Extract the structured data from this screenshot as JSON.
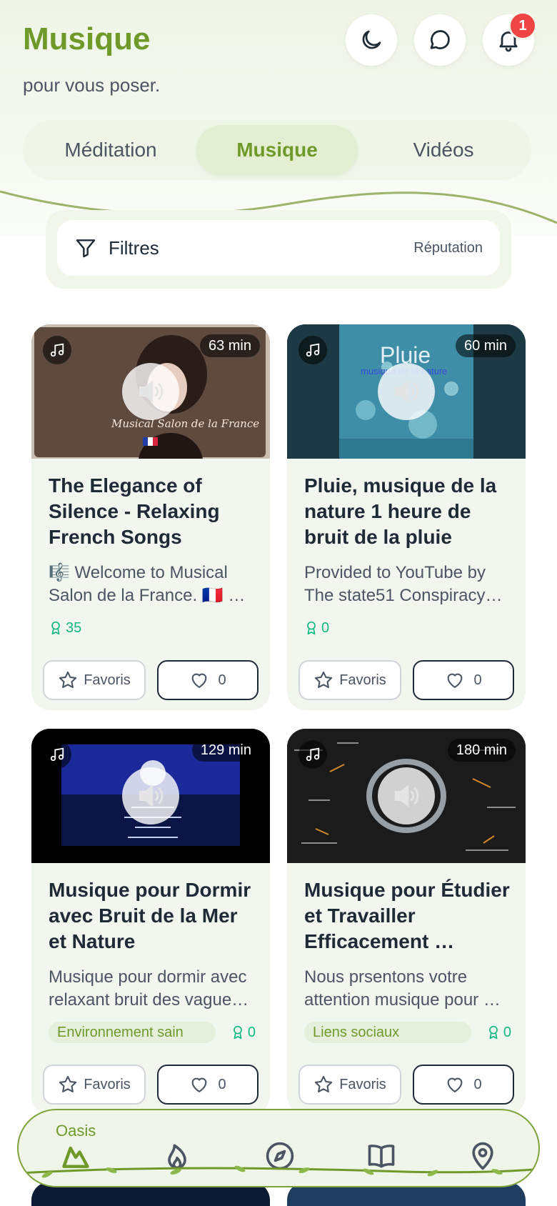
{
  "header": {
    "title": "Musique",
    "subtitle": "pour vous poser.",
    "notification_count": "1",
    "icons": [
      "moon-icon",
      "chat-icon",
      "bell-icon"
    ]
  },
  "tabs": [
    {
      "label": "Méditation",
      "active": false
    },
    {
      "label": "Musique",
      "active": true
    },
    {
      "label": "Vidéos",
      "active": false
    }
  ],
  "filters": {
    "label": "Filtres",
    "sort_label": "Réputation"
  },
  "cards": [
    {
      "duration": "63 min",
      "title": "The Elegance of Silence - Relaxing French Songs",
      "description": "🎼 Welcome to Musical Salon de la France. 🇫🇷 …",
      "tag": "",
      "points": "35",
      "favorite_label": "Favoris",
      "likes": "0"
    },
    {
      "duration": "60 min",
      "title": "Pluie, musique de la nature 1 heure de bruit de la pluie",
      "description": "Provided to YouTube by The state51 Conspiracy…",
      "tag": "",
      "points": "0",
      "favorite_label": "Favoris",
      "likes": "0",
      "thumb_text": "Pluie",
      "thumb_subtext": "musique de la nature"
    },
    {
      "duration": "129 min",
      "title": "Musique pour Dormir avec Bruit de la Mer et Nature",
      "description": "Musique pour dormir avec relaxant bruit des vague…",
      "tag": "Environnement sain",
      "points": "0",
      "favorite_label": "Favoris",
      "likes": "0"
    },
    {
      "duration": "180 min",
      "title": "Musique pour Étudier et Travailler Efficacement …",
      "description": "Nous prsentons votre attention musique pour …",
      "tag": "Liens sociaux",
      "points": "0",
      "favorite_label": "Favoris",
      "likes": "0"
    }
  ],
  "bottom_nav": {
    "home_label": "Oasis",
    "items": [
      "mountain-icon",
      "flame-icon",
      "compass-icon",
      "book-icon",
      "map-pin-icon"
    ]
  },
  "colors": {
    "accent": "#6f9a2a",
    "card_bg": "#f1f6ee",
    "badge": "#ef4444",
    "points": "#10b981"
  }
}
